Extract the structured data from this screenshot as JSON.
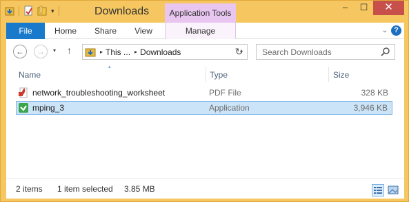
{
  "window": {
    "title": "Downloads",
    "contextual_tab_header": "Application Tools",
    "minimize_glyph": "–",
    "maximize_glyph": "☐",
    "close_glyph": "✕"
  },
  "ribbon": {
    "tabs": [
      "File",
      "Home",
      "Share",
      "View",
      "Manage"
    ],
    "collapse_glyph": "⌄",
    "help_glyph": "?"
  },
  "navigation": {
    "back_glyph": "←",
    "forward_glyph": "→",
    "recent_glyph": "▾",
    "up_glyph": "↑",
    "breadcrumb": [
      "This ...",
      "Downloads"
    ],
    "breadcrumb_separator": "▸",
    "address_dropdown_glyph": "▾",
    "refresh_glyph": "↻",
    "search_placeholder": "Search Downloads"
  },
  "file_list": {
    "columns": [
      "Name",
      "Type",
      "Size"
    ],
    "sort_indicator": "▴",
    "rows": [
      {
        "name": "network_troubleshooting_worksheet",
        "type": "PDF File",
        "size": "328 KB",
        "icon": "pdf-icon",
        "selected": false
      },
      {
        "name": "mping_3",
        "type": "Application",
        "size": "3,946 KB",
        "icon": "installer-icon",
        "selected": true
      }
    ]
  },
  "status_bar": {
    "item_count": "2 items",
    "selection": "1 item selected",
    "selection_size": "3.85 MB"
  },
  "colors": {
    "frame": "#f6c760",
    "file_tab": "#1979ca",
    "contextual_tab": "#e9c6f0",
    "close_button": "#c7504a",
    "selection_fill": "#cce4f7",
    "selection_border": "#7eb4ea"
  }
}
